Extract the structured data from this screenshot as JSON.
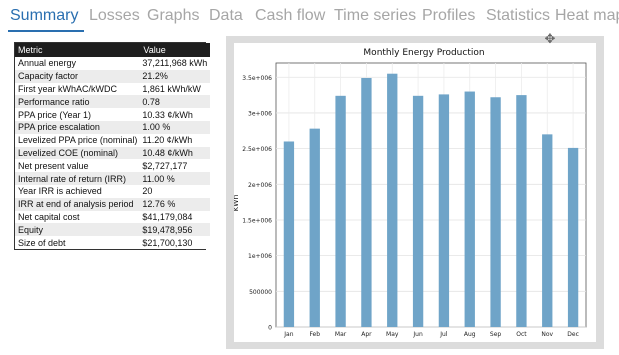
{
  "tabs": [
    {
      "label": "Summary",
      "active": true
    },
    {
      "label": "Losses",
      "active": false
    },
    {
      "label": "Graphs",
      "active": false
    },
    {
      "label": "Data",
      "active": false
    },
    {
      "label": "Cash flow",
      "active": false
    },
    {
      "label": "Time series",
      "active": false
    },
    {
      "label": "Profiles",
      "active": false
    },
    {
      "label": "Statistics",
      "active": false
    },
    {
      "label": "Heat map",
      "active": false
    }
  ],
  "metrics": {
    "header_metric": "Metric",
    "header_value": "Value",
    "rows": [
      {
        "metric": "Annual energy",
        "value": "37,211,968 kWh"
      },
      {
        "metric": "Capacity factor",
        "value": "21.2%"
      },
      {
        "metric": "First year kWhAC/kWDC",
        "value": "1,861 kWh/kW"
      },
      {
        "metric": "Performance ratio",
        "value": "0.78"
      },
      {
        "metric": "PPA price (Year 1)",
        "value": "10.33 ¢/kWh"
      },
      {
        "metric": "PPA price escalation",
        "value": "1.00 %"
      },
      {
        "metric": "Levelized PPA price (nominal)",
        "value": "11.20 ¢/kWh"
      },
      {
        "metric": "Levelized COE (nominal)",
        "value": "10.48 ¢/kWh"
      },
      {
        "metric": "Net present value",
        "value": "$2,727,177"
      },
      {
        "metric": "Internal rate of return (IRR)",
        "value": "11.00 %"
      },
      {
        "metric": "Year IRR is achieved",
        "value": "20"
      },
      {
        "metric": "IRR at end of analysis period",
        "value": "12.76 %"
      },
      {
        "metric": "Net capital cost",
        "value": "$41,179,084"
      },
      {
        "metric": "Equity",
        "value": "$19,478,956"
      },
      {
        "metric": "Size of debt",
        "value": "$21,700,130"
      }
    ]
  },
  "icons": {
    "move": "move-icon"
  },
  "colors": {
    "accent": "#2a6fb0",
    "bar": "#6fa4c8"
  },
  "chart_data": {
    "type": "bar",
    "title": "Monthly Energy Production",
    "ylabel": "kWh",
    "xlabel": "",
    "categories": [
      "Jan",
      "Feb",
      "Mar",
      "Apr",
      "May",
      "Jun",
      "Jul",
      "Aug",
      "Sep",
      "Oct",
      "Nov",
      "Dec"
    ],
    "values": [
      2600000,
      2780000,
      3240000,
      3490000,
      3550000,
      3240000,
      3260000,
      3300000,
      3220000,
      3250000,
      2700000,
      2510000
    ],
    "ylim": [
      0,
      3700000
    ],
    "yticks": [
      0,
      500000,
      1000000,
      1500000,
      2000000,
      2500000,
      3000000,
      3500000
    ],
    "ytick_labels": [
      "0",
      "500000",
      "1e+006",
      "1.5e+006",
      "2e+006",
      "2.5e+006",
      "3e+006",
      "3.5e+006"
    ],
    "grid": true
  }
}
